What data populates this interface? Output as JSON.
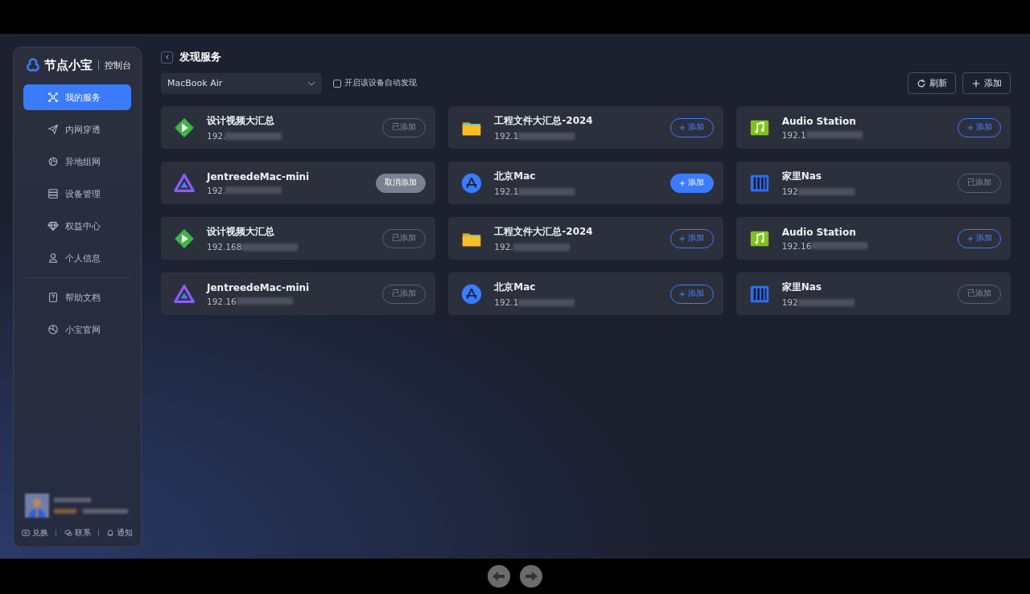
{
  "sidebar": {
    "logo": {
      "name": "节点小宝",
      "suffix": "控制台"
    },
    "items": [
      {
        "label": "我的服务",
        "selected": true
      },
      {
        "label": "内网穿透",
        "selected": false
      },
      {
        "label": "异地组网",
        "selected": false
      },
      {
        "label": "设备管理",
        "selected": false
      },
      {
        "label": "权益中心",
        "selected": false
      },
      {
        "label": "个人信息",
        "selected": false
      }
    ],
    "help_items": [
      {
        "label": "帮助文档",
        "selected": false
      },
      {
        "label": "小宝官网",
        "selected": false
      }
    ],
    "footer_links": [
      {
        "label": "兑换"
      },
      {
        "label": "联系"
      },
      {
        "label": "通知"
      }
    ]
  },
  "page": {
    "title": "发现服务",
    "device_select": {
      "value": "MacBook Air"
    },
    "auto_discover": {
      "label": "开启该设备自动发现",
      "checked": false
    },
    "buttons": [
      {
        "label": "刷新"
      },
      {
        "label": "添加"
      }
    ]
  },
  "services": [
    {
      "name": "设计视频大汇总",
      "ip": "192.",
      "kind": "video",
      "action": {
        "label": "已添加",
        "kind": "added"
      }
    },
    {
      "name": "工程文件大汇总-2024",
      "ip": "192.1",
      "kind": "folder",
      "action": {
        "label": "添加",
        "kind": "add"
      }
    },
    {
      "name": "Audio Station",
      "ip": "192.1",
      "kind": "music",
      "action": {
        "label": "添加",
        "kind": "add"
      }
    },
    {
      "name": "JentreedeMac-mini",
      "ip": "192.",
      "kind": "media",
      "action": {
        "label": "取消添加",
        "kind": "cancel"
      }
    },
    {
      "name": "北京Mac",
      "ip": "192.1",
      "kind": "store",
      "action": {
        "label": "添加",
        "kind": "primary"
      }
    },
    {
      "name": "家里Nas",
      "ip": "192",
      "kind": "nas",
      "action": {
        "label": "已添加",
        "kind": "added"
      }
    },
    {
      "name": "设计视频大汇总",
      "ip": "192.168",
      "kind": "video",
      "action": {
        "label": "已添加",
        "kind": "added"
      }
    },
    {
      "name": "工程文件大汇总-2024",
      "ip": "192.",
      "kind": "folder",
      "action": {
        "label": "添加",
        "kind": "add"
      }
    },
    {
      "name": "Audio Station",
      "ip": "192.16",
      "kind": "music",
      "action": {
        "label": "添加",
        "kind": "add"
      }
    },
    {
      "name": "JentreedeMac-mini",
      "ip": "192.16",
      "kind": "media",
      "action": {
        "label": "已添加",
        "kind": "added"
      }
    },
    {
      "name": "北京Mac",
      "ip": "192.1",
      "kind": "store",
      "action": {
        "label": "添加",
        "kind": "add"
      }
    },
    {
      "name": "家里Nas",
      "ip": "192",
      "kind": "nas",
      "action": {
        "label": "已添加",
        "kind": "added"
      }
    }
  ]
}
